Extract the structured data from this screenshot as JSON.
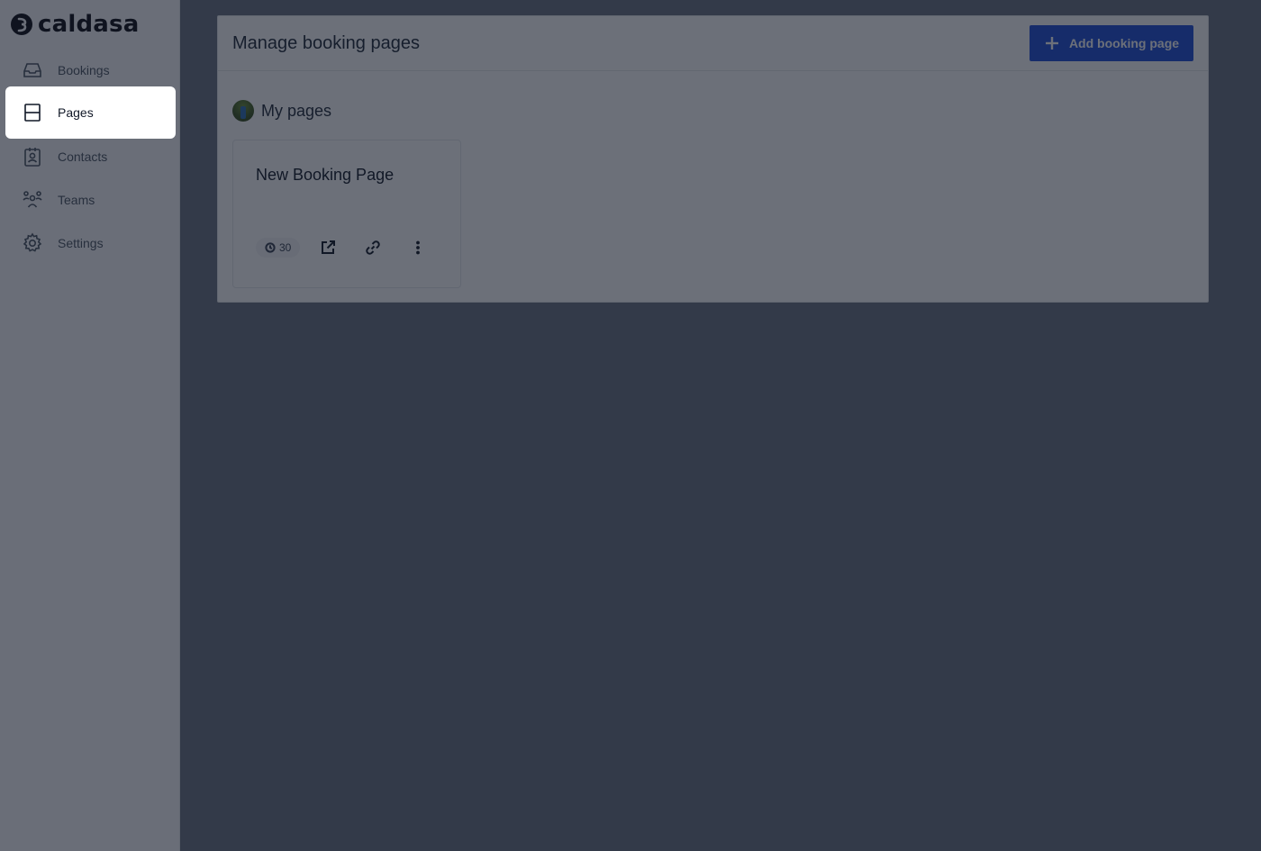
{
  "app": {
    "name": "caldasa"
  },
  "sidebar": {
    "items": [
      {
        "label": "Bookings",
        "icon": "inbox-icon"
      },
      {
        "label": "Pages",
        "icon": "page-layout-icon",
        "active": true
      },
      {
        "label": "Contacts",
        "icon": "contacts-icon"
      },
      {
        "label": "Teams",
        "icon": "team-icon"
      },
      {
        "label": "Settings",
        "icon": "gear-icon"
      }
    ]
  },
  "main": {
    "title": "Manage booking pages",
    "add_button_label": "Add booking page",
    "section_title": "My pages",
    "cards": [
      {
        "title": "New Booking Page",
        "duration": "30"
      }
    ]
  },
  "colors": {
    "accent": "#1d4ed8",
    "overlay": "rgba(17,24,39,0.62)"
  }
}
